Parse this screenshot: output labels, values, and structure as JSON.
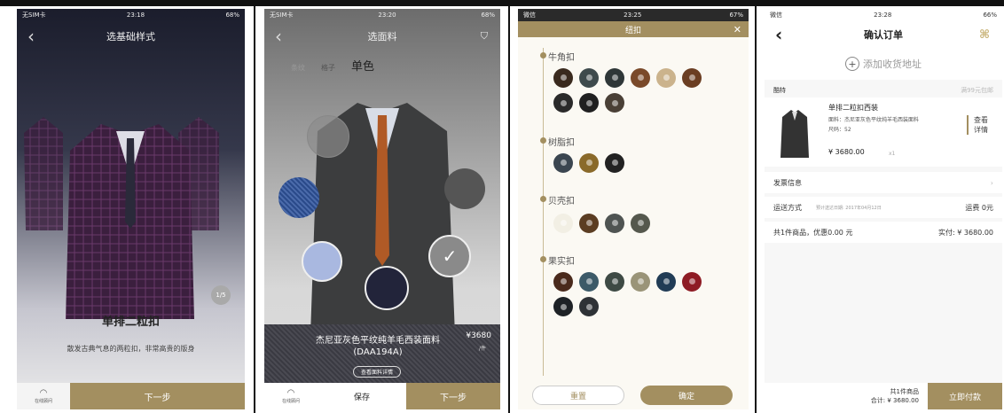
{
  "screen1": {
    "status_left": "无SIM卡",
    "time": "23:18",
    "battery": "68%",
    "title": "选基础样式",
    "page": "1/5",
    "style_name": "单排二粒扣",
    "description": "散发古典气息的两粒扣，非常高贵的版身",
    "service_label": "在线顾问",
    "next_label": "下一步"
  },
  "screen2": {
    "status_left": "无SIM卡",
    "time": "23:20",
    "battery": "68%",
    "title": "选面料",
    "tabs": [
      "条纹",
      "格子",
      "单色"
    ],
    "fabric_name": "杰尼亚灰色平纹纯羊毛西装面料(DAA194A)",
    "price": "¥3680",
    "price_unit": "/件",
    "detail_label": "查看面料详情",
    "service_label": "在线顾问",
    "save_label": "保存",
    "next_label": "下一步"
  },
  "screen3": {
    "status_left": "微信",
    "time": "23:25",
    "battery": "67%",
    "title": "纽扣",
    "sections": [
      {
        "name": "牛角扣",
        "colors": [
          "#3a2a1e",
          "#3e4a4c",
          "#2f3738",
          "#7a4a2a",
          "#cbb38c",
          "#6b3e22",
          "#2a2a2a",
          "#202020",
          "#4a4036"
        ]
      },
      {
        "name": "树脂扣",
        "colors": [
          "#3b4650",
          "#8a6a2a",
          "#222222"
        ]
      },
      {
        "name": "贝壳扣",
        "colors": [
          "#f2efe4",
          "#5b3d22",
          "#4f5452",
          "#55584d"
        ]
      },
      {
        "name": "果实扣",
        "colors": [
          "#4a2a1c",
          "#3c5a68",
          "#3e4a44",
          "#9a9478",
          "#213c55",
          "#8e1c24",
          "#1e2226",
          "#2e3236"
        ]
      }
    ],
    "reset_label": "重置",
    "confirm_label": "确定"
  },
  "screen4": {
    "status_left": "微信",
    "time": "23:28",
    "battery": "66%",
    "title": "确认订单",
    "add_address": "添加收货地址",
    "shop": "酷特",
    "shipping_note": "满99元包邮",
    "product_name": "单排二粒扣西装",
    "fabric": "面料：杰尼亚灰色平纹纯羊毛西装面料",
    "size": "尺码：52",
    "price": "¥ 3680.00",
    "qty": "x1",
    "detail_btn": "查看详情",
    "invoice": "发票信息",
    "delivery": "运送方式",
    "delivery_date": "预计送达日期: 2017年04月12日",
    "delivery_fee": "运费 0元",
    "summary_left": "共1件商品，优惠0.00 元",
    "summary_right": "实付: ¥ 3680.00",
    "footer_count": "共1件商品",
    "footer_total": "合计: ¥ 3680.00",
    "pay_label": "立即付款"
  }
}
